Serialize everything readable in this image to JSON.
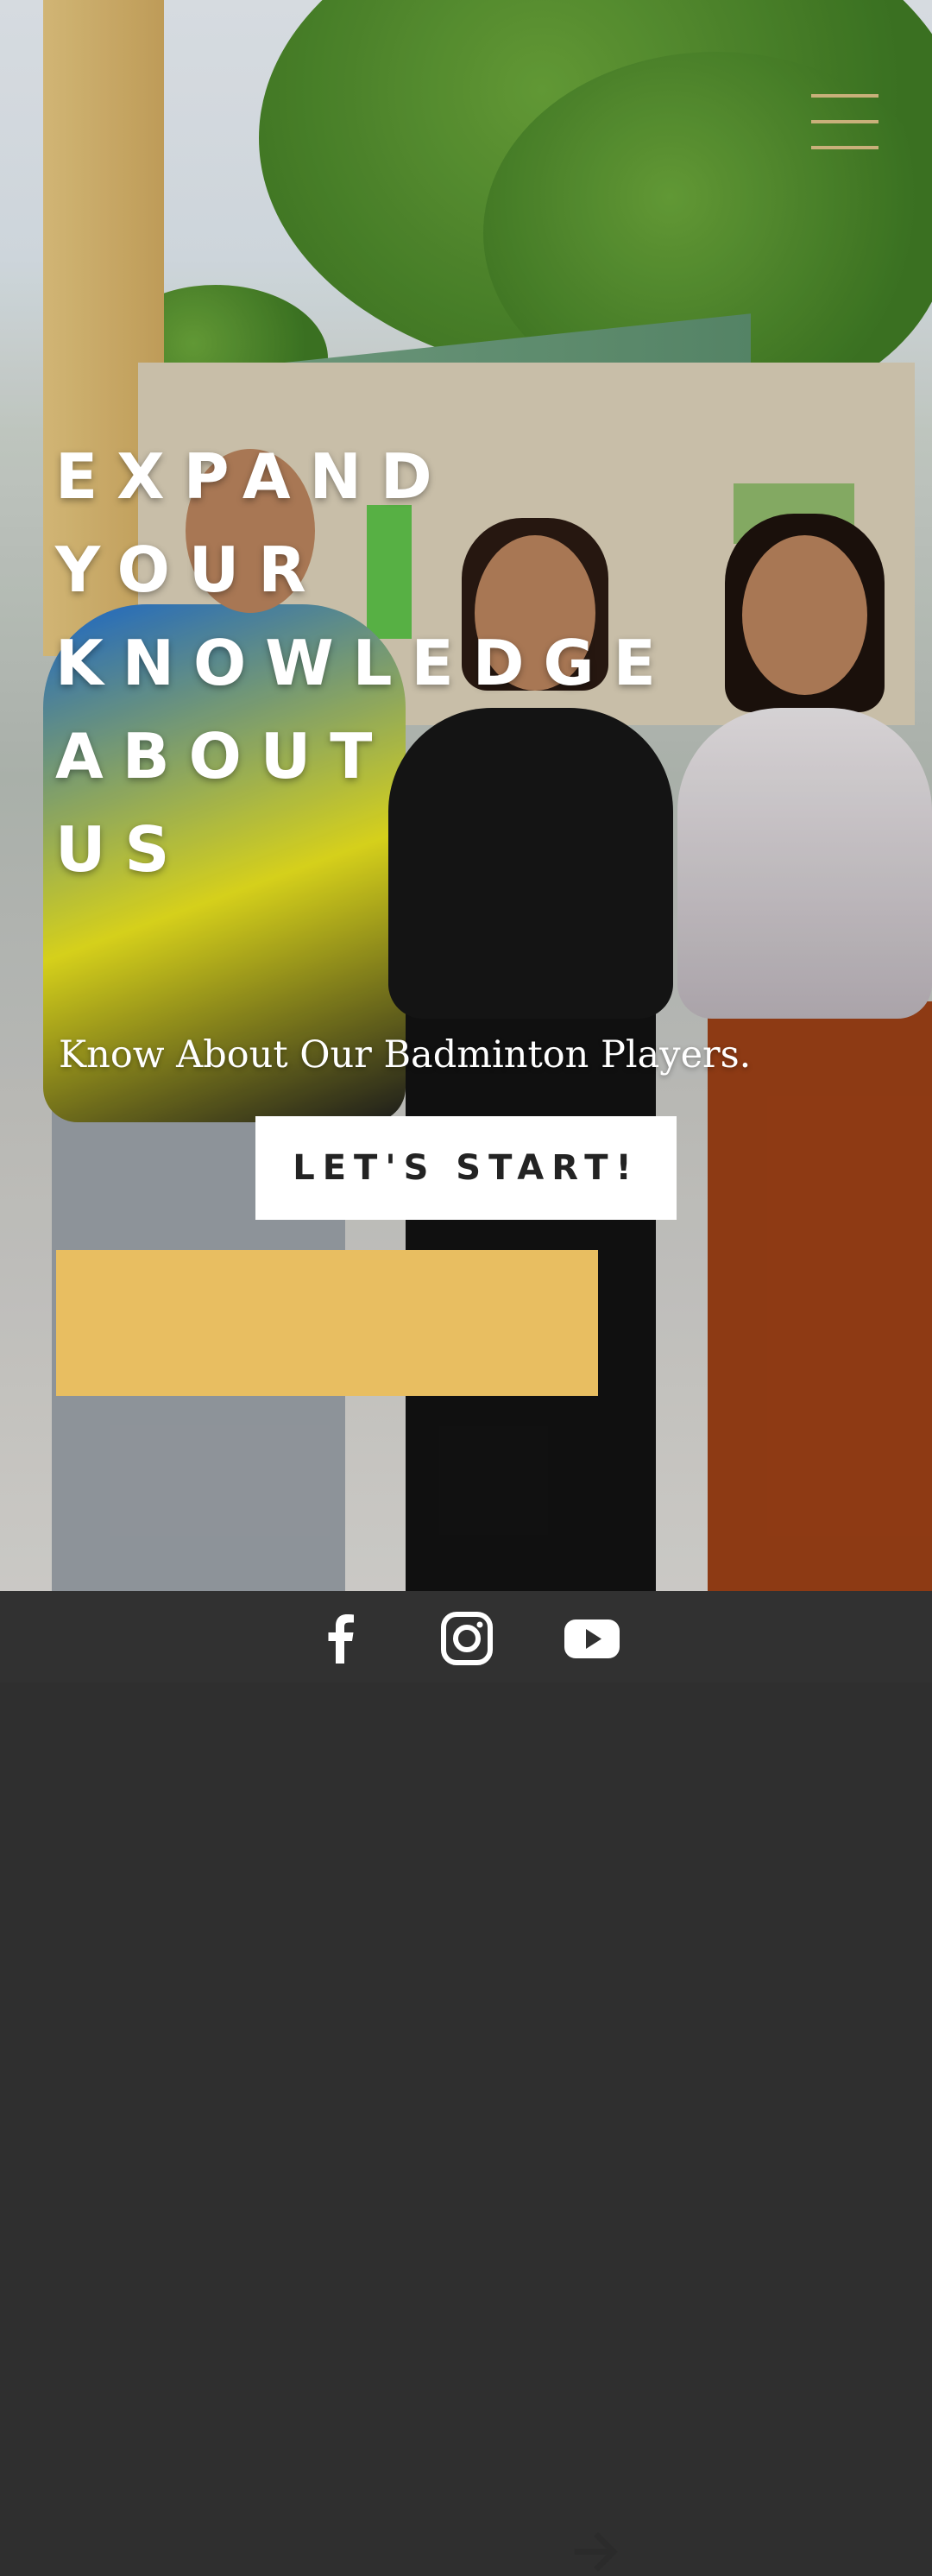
{
  "hero": {
    "headline_lines": [
      "EXPAND",
      "YOUR",
      "KNOWLEDGE",
      "ABOUT",
      "US"
    ],
    "subtitle": "Know About Our Badminton Players.",
    "start_button_label": "LET'S START!"
  },
  "header": {
    "menu_icon": "hamburger-menu-icon"
  },
  "cta": {
    "icon": "arrow-right-icon"
  },
  "footer": {
    "social_icons": [
      "facebook-icon",
      "instagram-icon",
      "youtube-icon"
    ]
  },
  "colors": {
    "accent": "#e8be61",
    "menu_lines": "#c9b07a",
    "footer_bg": "#313131",
    "button_bg": "#ffffff",
    "button_text": "#232323"
  }
}
